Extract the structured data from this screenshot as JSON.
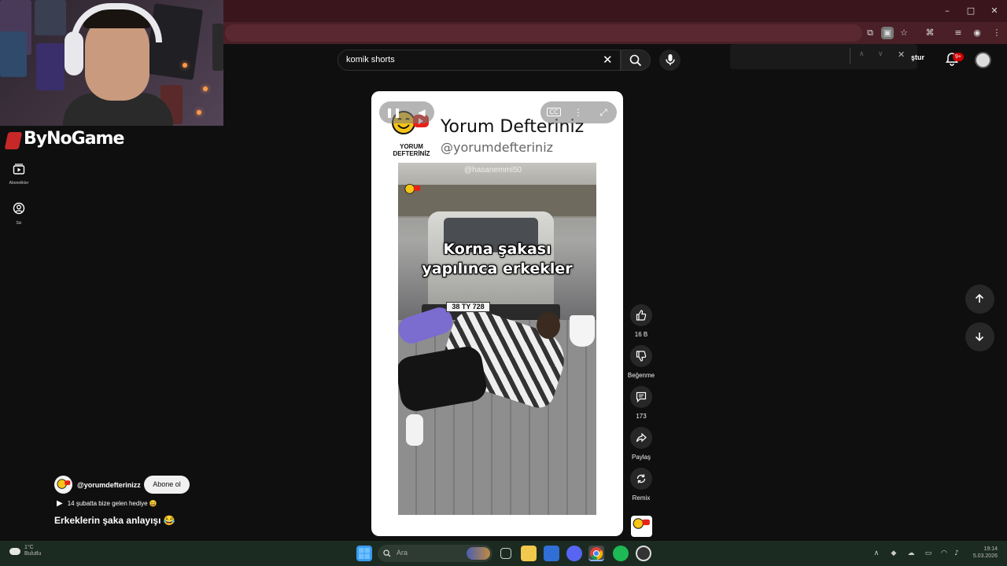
{
  "browser": {
    "window_controls": {
      "minimize": "–",
      "maximize": "□",
      "close": "✕"
    },
    "toolbar_icons": [
      "screen-share-icon",
      "extension-icon",
      "star-icon",
      "translate-icon",
      "media-icon",
      "vpn-icon",
      "menu-icon"
    ]
  },
  "youtube": {
    "search": {
      "value": "komik shorts"
    },
    "create_label": "ştur",
    "notifications_badge": "9+",
    "sidebar": [
      {
        "label": "Abonelikler",
        "icon": "subscriptions-icon"
      },
      {
        "label": "Siz",
        "icon": "you-icon"
      }
    ]
  },
  "stream_overlay": {
    "brand": "ByNoGame"
  },
  "short": {
    "channel_display_name": "Yorum Defteriniz",
    "channel_handle_display": "@yorumdefteriniz",
    "logo_text": [
      "YORUM",
      "DEFTERİNİZ"
    ],
    "video_watermark": "@hasanemmi50",
    "caption_line1": "Korna şakası",
    "caption_line2": "yapılınca erkekler",
    "plate": "38 TY 728",
    "actions": {
      "like_count": "16 B",
      "dislike_label": "Beğenme",
      "comment_count": "173",
      "share_label": "Paylaş",
      "remix_label": "Remix"
    },
    "info": {
      "channel_handle": "@yorumdefterinizz",
      "subscribe_label": "Abone ol",
      "playlist_text": "14 şubatta bize gelen hediye 😄",
      "title": "Erkeklerin şaka anlayışı 😂"
    }
  },
  "taskbar": {
    "search_placeholder": "Ara",
    "clock_time": "19:14",
    "clock_date": "5.03.2026",
    "weather_temp": "1°C",
    "weather_desc": "Bulutlu",
    "apps": [
      "windows-icon",
      "task-view-icon",
      "file-explorer-icon",
      "store-icon",
      "discord-icon",
      "chrome-icon",
      "spotify-icon",
      "app-icon"
    ]
  },
  "colors": {
    "titlebar": "#3a161c",
    "toolbar": "#4a1f26",
    "youtube_bg": "#0f0f0f",
    "accent_red": "#cc0000"
  }
}
